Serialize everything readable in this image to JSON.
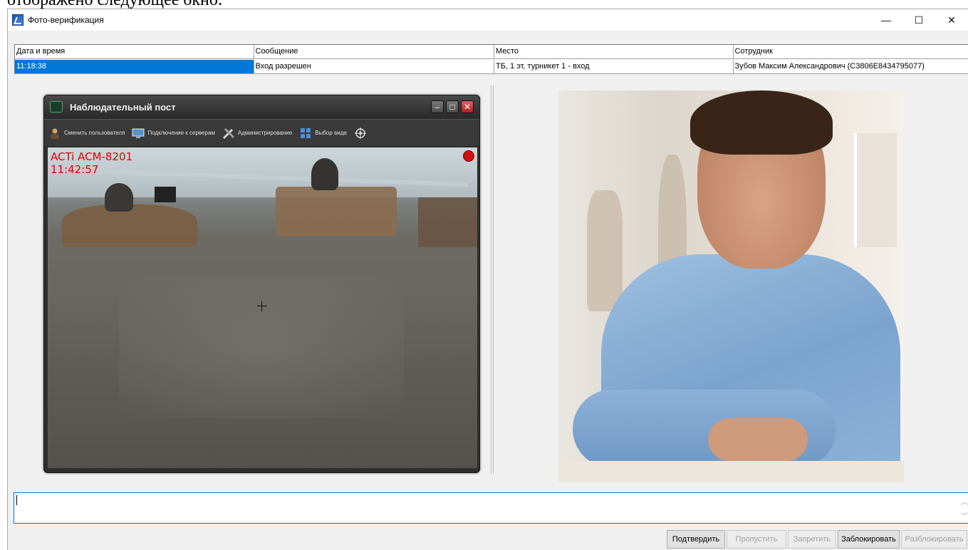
{
  "page_caption": "отображено следующее окно:",
  "window": {
    "title": "Фото-верификация",
    "controls": {
      "minimize": "—",
      "maximize": "☐",
      "close": "✕"
    }
  },
  "grid": {
    "columns": [
      "Дата и время",
      "Сообщение",
      "Место",
      "Сотрудник"
    ],
    "rows": [
      [
        "11:18:38",
        "Вход разрешен",
        "ТБ, 1 эт, турникет 1 - вход",
        "Зубов Максим Александрович (C3806E8434795077)"
      ]
    ]
  },
  "observation_post": {
    "title": "Наблюдательный пост",
    "toolbar": [
      {
        "label": "Сменить пользователя",
        "icon": "user-icon"
      },
      {
        "label": "Подключение к серверам",
        "icon": "servers-icon"
      },
      {
        "label": "Администрирование",
        "icon": "tools-icon"
      },
      {
        "label": "Выбор вида",
        "icon": "layout-icon"
      },
      {
        "label": "",
        "icon": "network-icon"
      }
    ],
    "camera": {
      "name": "ACTi ACM-8201",
      "time": "11:42:57"
    }
  },
  "buttons": {
    "confirm": "Подтвердить",
    "skip": "Пропустить",
    "deny": "Запретить",
    "block": "Заблокировать",
    "unblock": "Разблокировать"
  },
  "comment": {
    "value": ""
  },
  "colors": {
    "selection": "#0078d7",
    "camera_text": "#e00000"
  }
}
